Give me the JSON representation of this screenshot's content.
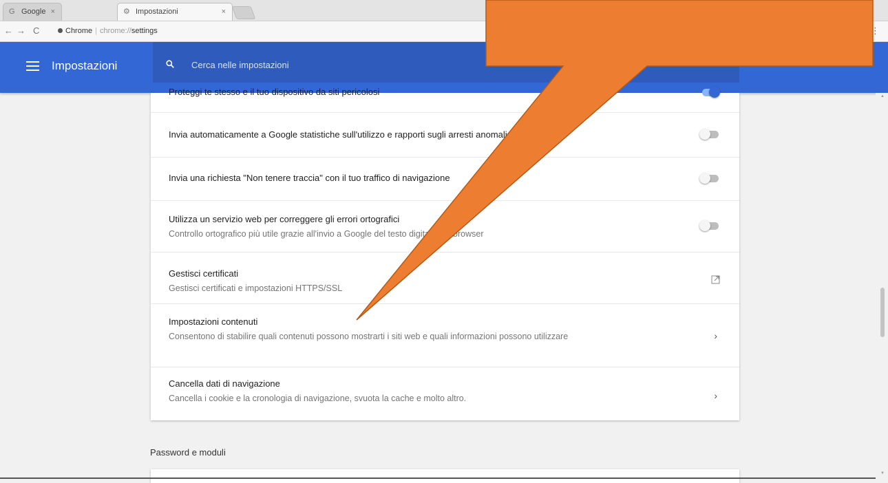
{
  "browser": {
    "tabs": [
      {
        "label": "Google",
        "icon": "google-icon"
      },
      {
        "label": "Impostazioni",
        "icon": "gear-icon"
      }
    ],
    "omnibox": {
      "secure_label": "Chrome",
      "url_host": "chrome://",
      "url_path": "settings"
    }
  },
  "header": {
    "title": "Impostazioni",
    "search_placeholder": "Cerca nelle impostazioni",
    "color": "#3367d6"
  },
  "settings": {
    "rows": [
      {
        "title": "Proteggi te stesso e il tuo dispositivo da siti pericolosi",
        "control": "toggle",
        "on": true
      },
      {
        "title": "Invia automaticamente a Google statistiche sull'utilizzo e rapporti sugli arresti anomali",
        "control": "toggle",
        "on": false
      },
      {
        "title": "Invia una richiesta \"Non tenere traccia\" con il tuo traffico di navigazione",
        "control": "toggle",
        "on": false
      },
      {
        "title": "Utilizza un servizio web per correggere gli errori ortografici",
        "subtitle": "Controllo ortografico più utile grazie all'invio a Google del testo digitato nel browser",
        "control": "toggle",
        "on": false
      },
      {
        "title": "Gestisci certificati",
        "subtitle": "Gestisci certificati e impostazioni HTTPS/SSL",
        "control": "external-link"
      },
      {
        "title": "Impostazioni contenuti",
        "subtitle": "Consentono di stabilire quali contenuti possono mostrarti i siti web e quali informazioni possono utilizzare",
        "control": "chevron"
      },
      {
        "title": "Cancella dati di navigazione",
        "subtitle": "Cancella i cookie e la cronologia di navigazione, svuota la cache e molto altro.",
        "control": "chevron"
      }
    ],
    "next_section_title": "Password e moduli"
  },
  "callout": {
    "color": "#ed7d31"
  }
}
